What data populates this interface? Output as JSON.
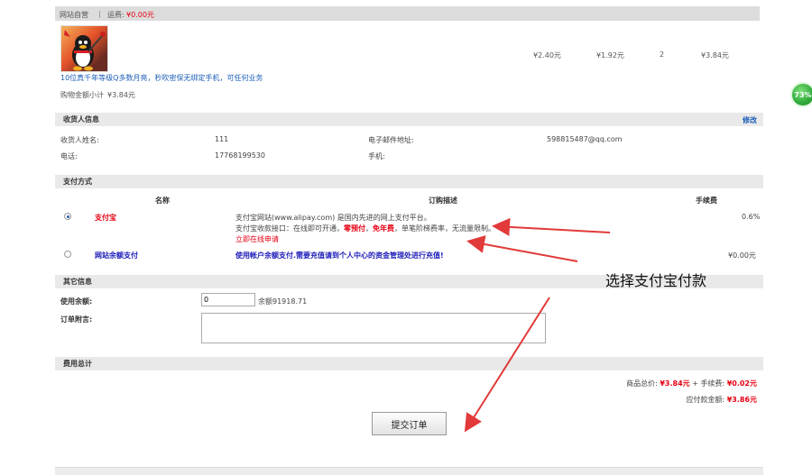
{
  "store": {
    "label": "网站自营",
    "separator": "|",
    "shipping_label": "运费:",
    "shipping_value": "¥0.00元"
  },
  "product": {
    "title": "10位真千年等级Q多数月亮，秒吹密保无绑定手机，可任何业务",
    "price": "¥2.40元",
    "member_price": "¥1.92元",
    "quantity": "2",
    "subtotal": "¥3.84元",
    "cart_total_label": "购物金额小计",
    "cart_total_value": "¥3.84元"
  },
  "recipient": {
    "title": "收货人信息",
    "edit_link": "修改",
    "name_label": "收货人姓名:",
    "name_value": "111",
    "email_label": "电子邮件地址:",
    "email_value": "598815487@qq.com",
    "phone_label": "电话:",
    "phone_value": "17768199530",
    "mobile_label": "手机:",
    "mobile_value": ""
  },
  "payment": {
    "title": "支付方式",
    "col_name": "名称",
    "col_desc": "订购描述",
    "col_fee": "手续费",
    "alipay": {
      "name": "支付宝",
      "desc1": "支付宝网站(www.alipay.com) 是国内先进的网上支付平台。",
      "desc2_prefix": "支付宝收款接口：在线即可开通，",
      "desc2_bold1": "零预付",
      "desc2_sep": "，",
      "desc2_bold2": "免年费",
      "desc2_suffix": "，单笔阶梯费率，无流量限制。",
      "apply_link": "立即在线申请",
      "fee": "0.6%",
      "selected": true
    },
    "balance": {
      "name": "网站余额支付",
      "desc": "使用帐户余额支付.需要充值请到个人中心的资金管理处进行充值!",
      "fee": "¥0.00元",
      "selected": false
    }
  },
  "other": {
    "title": "其它信息",
    "balance_label": "使用余额:",
    "balance_value": "0",
    "balance_note": "余额91918.71",
    "message_label": "订单附言:",
    "message_value": ""
  },
  "totals": {
    "title": "费用总计",
    "goods_label": "商品总价:",
    "goods_value": "¥3.84元",
    "plus": "+",
    "fee_label": "手续费:",
    "fee_value": "¥0.02元",
    "payable_label": "应付款金额:",
    "payable_value": "¥3.86元"
  },
  "submit_label": "提交订单",
  "annotation": "选择支付宝付款",
  "progress_badge": "73%",
  "colors": {
    "accent_red": "#e60012",
    "link_blue": "#1c5fb8",
    "annotation_red": "#e23a3a",
    "bar_gray": "#e9e9e9"
  }
}
